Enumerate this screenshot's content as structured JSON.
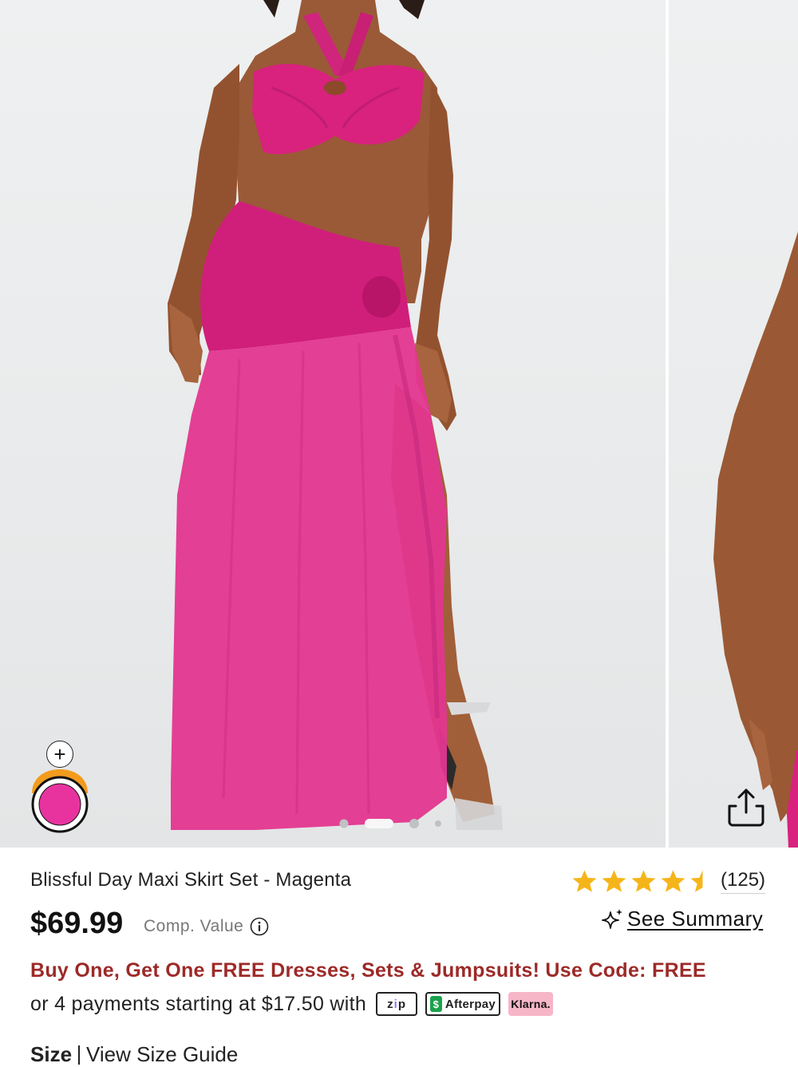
{
  "product": {
    "title": "Blissful Day Maxi Skirt Set - Magenta",
    "price": "$69.99",
    "comp_value_label": "Comp. Value",
    "review_count": "(125)",
    "rating": 4.5,
    "summary_label": "See Summary"
  },
  "promo": {
    "text": "Buy One, Get One FREE Dresses, Sets & Jumpsuits! Use Code: FREE",
    "color": "#9c2a28"
  },
  "payments": {
    "text": "or 4 payments starting at $17.50 with",
    "providers": [
      "zip",
      "Afterpay",
      "Klarna."
    ]
  },
  "size": {
    "label": "Size",
    "guide_link": "View Size Guide"
  },
  "gallery": {
    "add_label": "+",
    "selected_color": "#e8339f",
    "dot_count": 4,
    "active_dot": 1,
    "share_icon": "share-icon"
  },
  "colors": {
    "accent_magenta": "#d8227e",
    "star": "#f5b51a"
  }
}
